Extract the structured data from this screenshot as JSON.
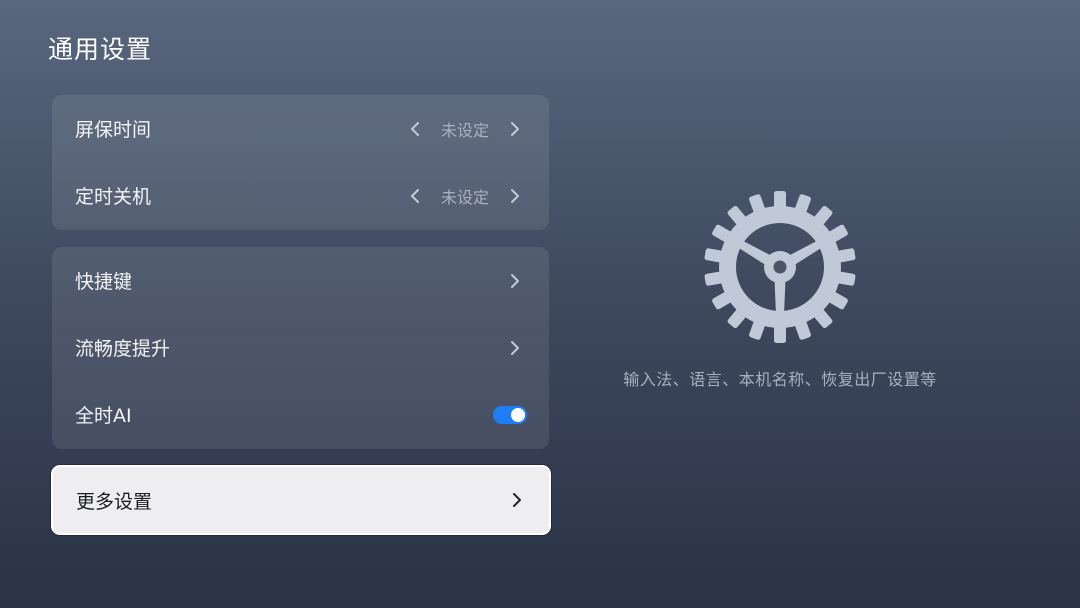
{
  "page": {
    "title": "通用设置"
  },
  "group1": {
    "items": [
      {
        "label": "屏保时间",
        "value": "未设定"
      },
      {
        "label": "定时关机",
        "value": "未设定"
      }
    ]
  },
  "group2": {
    "items": [
      {
        "label": "快捷键"
      },
      {
        "label": "流畅度提升"
      },
      {
        "label": "全时AI",
        "toggle_on": true
      }
    ]
  },
  "more": {
    "label": "更多设置"
  },
  "detail": {
    "icon": "gear-icon",
    "description": "输入法、语言、本机名称、恢复出厂设置等"
  },
  "colors": {
    "toggle_on": "#1f7ef5",
    "focus_bg": "#eeeef0"
  }
}
